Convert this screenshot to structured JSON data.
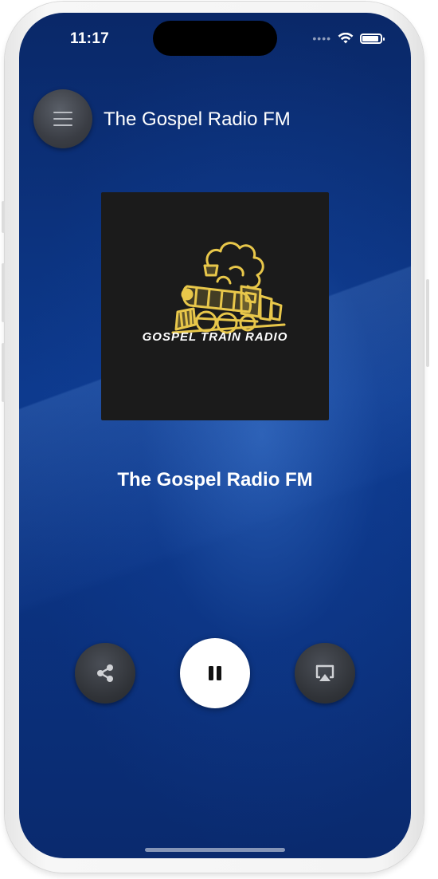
{
  "status_bar": {
    "time": "11:17",
    "signal_dots": "••••",
    "wifi_icon": "wifi-icon",
    "battery_icon": "battery-icon",
    "battery_level_fraction": 0.9
  },
  "header": {
    "menu_icon": "hamburger-menu-icon",
    "title": "The Gospel Radio FM"
  },
  "artwork": {
    "caption": "GOSPEL TRAIN RADIO",
    "image_icon": "steam-locomotive-logo",
    "accent_color": "#e8c74a"
  },
  "now_playing": {
    "station_name": "The Gospel Radio FM"
  },
  "controls": {
    "share_icon": "share-icon",
    "pause_icon": "pause-icon",
    "airplay_icon": "airplay-icon"
  },
  "colors": {
    "background_top": "#0a2868",
    "background_mid": "#0d3a8e",
    "button_dark": "#303338",
    "play_button": "#ffffff"
  }
}
